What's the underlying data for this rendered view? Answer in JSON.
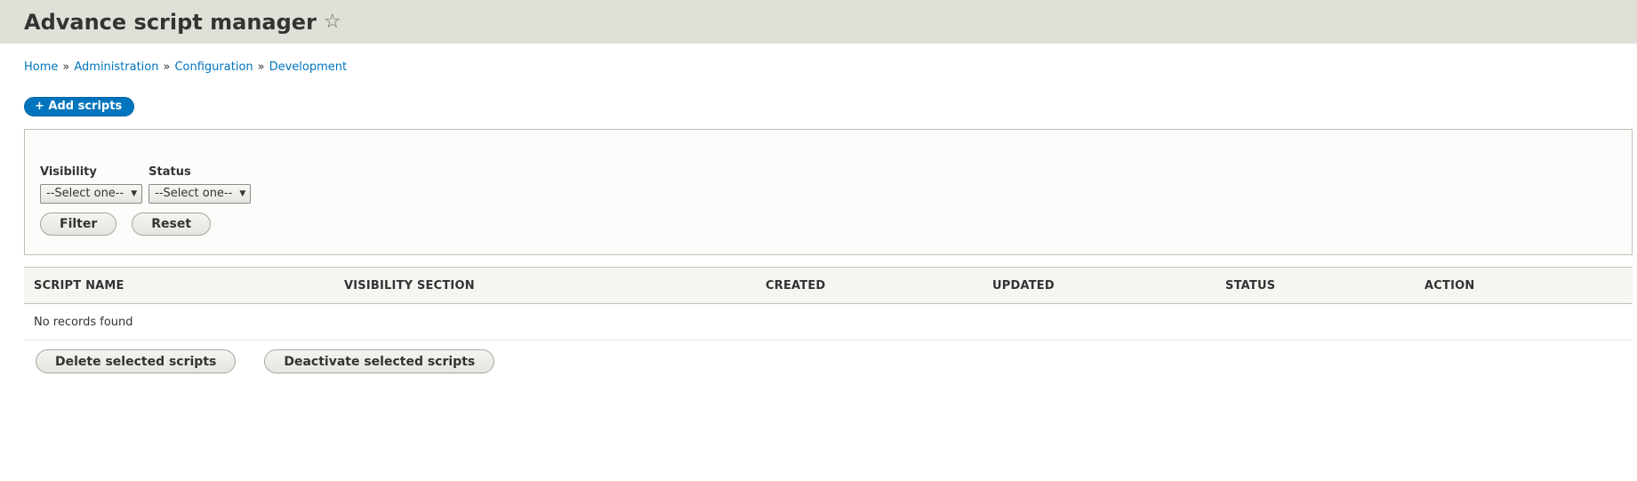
{
  "header": {
    "title": "Advance script manager",
    "star_icon": "star-icon"
  },
  "breadcrumb": {
    "items": [
      "Home",
      "Administration",
      "Configuration",
      "Development"
    ],
    "separator": "»"
  },
  "actions": {
    "add_scripts": "+ Add scripts"
  },
  "filters": {
    "visibility": {
      "label": "Visibility",
      "value": "--Select one--"
    },
    "status": {
      "label": "Status",
      "value": "--Select one--"
    },
    "filter_button": "Filter",
    "reset_button": "Reset"
  },
  "table": {
    "columns": [
      "Script name",
      "Visibility section",
      "Created",
      "Updated",
      "Status",
      "Action"
    ],
    "empty_message": "No records found"
  },
  "bulk_actions": {
    "delete": "Delete selected scripts",
    "deactivate": "Deactivate selected scripts"
  },
  "colors": {
    "header_bg": "#e0e0d8",
    "link": "#0074bd",
    "primary_button": "#0074bd"
  }
}
